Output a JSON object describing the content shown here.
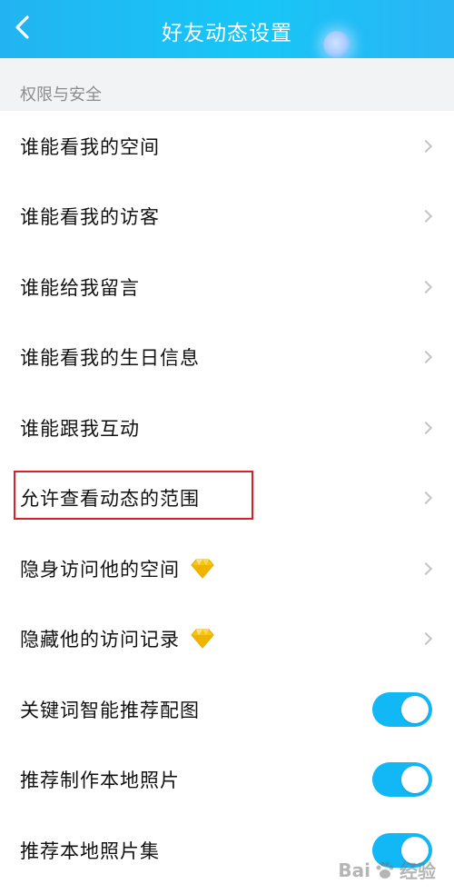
{
  "header": {
    "title": "好友动态设置",
    "background_color": "#1fb8f4",
    "back_icon": "chevron-left-icon"
  },
  "section": {
    "title": "权限与安全"
  },
  "items": [
    {
      "label": "谁能看我的空间",
      "type": "nav"
    },
    {
      "label": "谁能看我的访客",
      "type": "nav"
    },
    {
      "label": "谁能给我留言",
      "type": "nav"
    },
    {
      "label": "谁能看我的生日信息",
      "type": "nav"
    },
    {
      "label": "谁能跟我互动",
      "type": "nav"
    },
    {
      "label": "允许查看动态的范围",
      "type": "nav",
      "highlighted": true,
      "highlight_color": "#d6202a"
    },
    {
      "label": "隐身访问他的空间",
      "type": "nav",
      "icon": "diamond-icon"
    },
    {
      "label": "隐藏他的访问记录",
      "type": "nav",
      "icon": "diamond-icon"
    },
    {
      "label": "关键词智能推荐配图",
      "type": "toggle",
      "on": true
    },
    {
      "label": "推荐制作本地照片",
      "type": "toggle",
      "on": true
    },
    {
      "label": "推荐本地照片集",
      "type": "toggle",
      "on": true
    }
  ],
  "toggle_color": "#12b7f5",
  "watermark": {
    "text": "Bai",
    "icon": "paw-icon",
    "text2": "经验"
  }
}
